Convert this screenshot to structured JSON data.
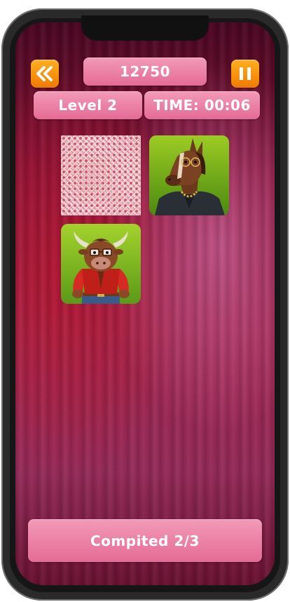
{
  "hud": {
    "score": "12750",
    "level_label": "Level 2",
    "timer_label": "TIME: 00:06"
  },
  "footer": {
    "status_label": "Compited 2/3"
  },
  "cards": [
    {
      "state": "face-down",
      "pattern": "lattice"
    },
    {
      "state": "face-up",
      "character": "horse-in-leather-jacket"
    },
    {
      "state": "face-up",
      "character": "bull-in-red-jacket"
    }
  ],
  "colors": {
    "pill": "#e46b95",
    "orange_button": "#f07a00",
    "background_dark": "#4a0520",
    "background_light": "#a3254e"
  },
  "icons": {
    "back": "double-chevron-left-icon",
    "pause": "pause-icon"
  }
}
